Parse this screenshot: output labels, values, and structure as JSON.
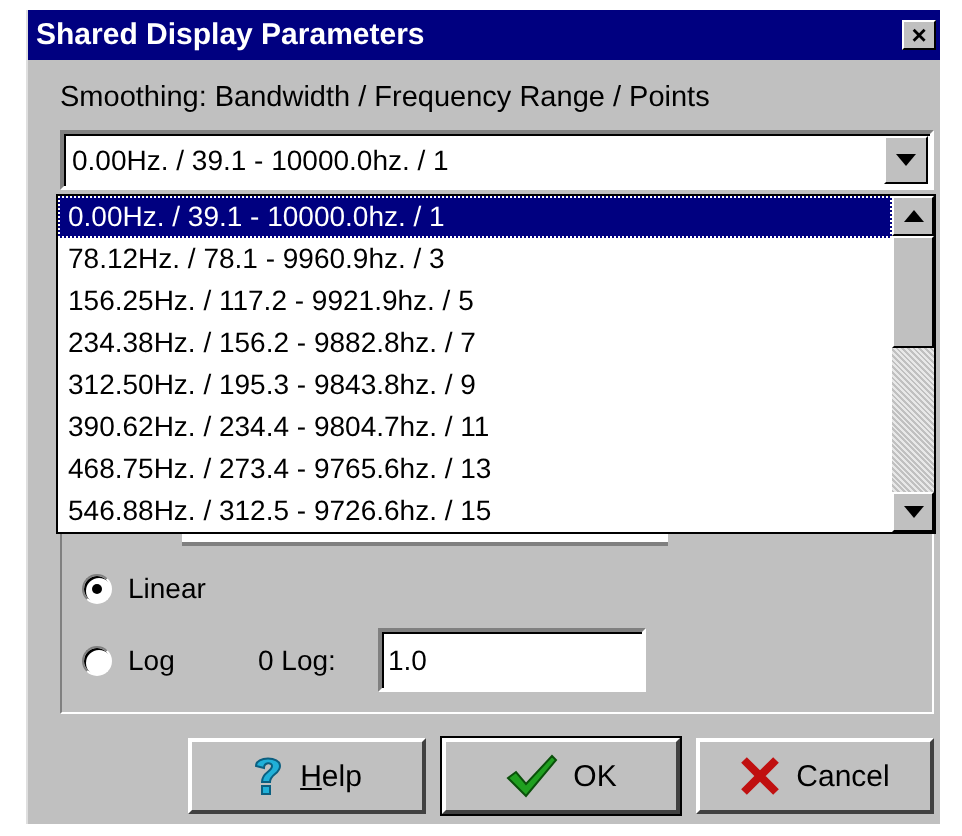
{
  "window": {
    "title": "Shared Display Parameters",
    "close": "×"
  },
  "smoothing": {
    "label": "Smoothing: Bandwidth / Frequency Range / Points",
    "value": "0.00Hz. / 39.1 - 10000.0hz. / 1",
    "expanded": true,
    "options": [
      {
        "label": "0.00Hz. / 39.1 - 10000.0hz. / 1",
        "selected": true
      },
      {
        "label": "78.12Hz. / 78.1 - 9960.9hz. / 3",
        "selected": false
      },
      {
        "label": "156.25Hz. / 117.2 - 9921.9hz. / 5",
        "selected": false
      },
      {
        "label": "234.38Hz. / 156.2 - 9882.8hz. / 7",
        "selected": false
      },
      {
        "label": "312.50Hz. / 195.3 - 9843.8hz. / 9",
        "selected": false
      },
      {
        "label": "390.62Hz. / 234.4 - 9804.7hz. / 11",
        "selected": false
      },
      {
        "label": "468.75Hz. / 273.4 - 9765.6hz. / 13",
        "selected": false
      },
      {
        "label": "546.88Hz. / 312.5 - 9726.6hz. / 15",
        "selected": false
      }
    ]
  },
  "scale": [
    {
      "label": "Linear",
      "selected": true
    },
    {
      "label": "Log",
      "selected": false
    }
  ],
  "zero_log": {
    "label": "0 Log:",
    "value": "1.0"
  },
  "buttons": [
    {
      "kind": "help",
      "label": "Help",
      "underline_first": true
    },
    {
      "kind": "ok",
      "label": "OK",
      "default": true
    },
    {
      "kind": "cancel",
      "label": "Cancel"
    }
  ]
}
